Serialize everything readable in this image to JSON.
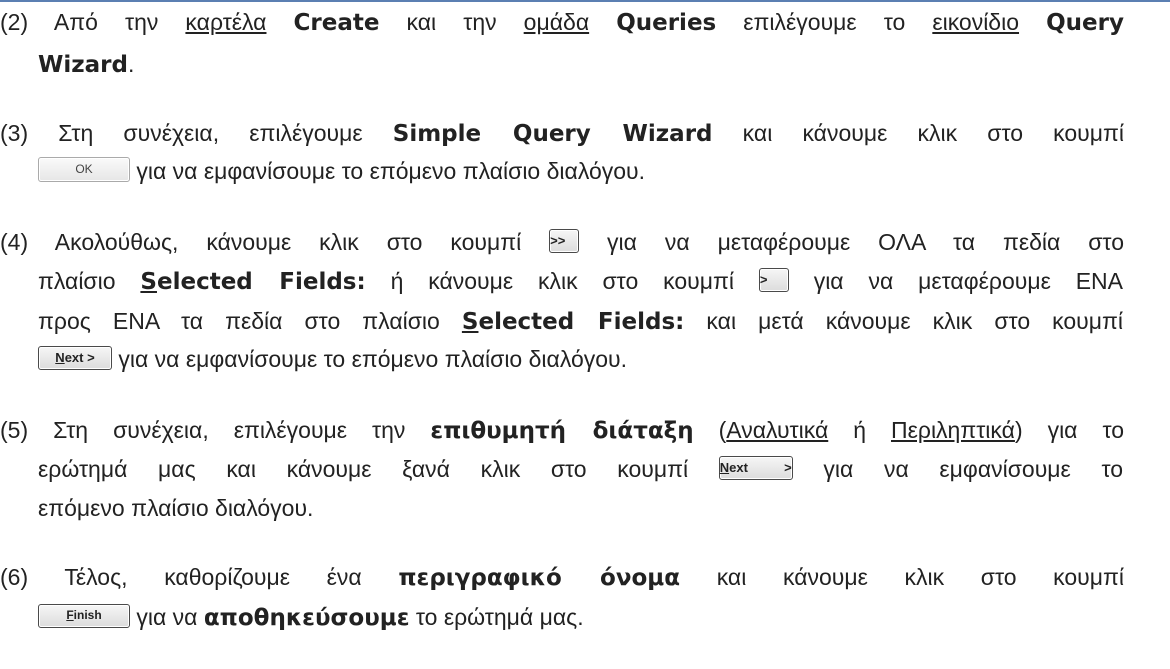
{
  "steps": [
    {
      "number": "(2)",
      "line1": {
        "t1": "Από την ",
        "u1": "καρτέλα",
        "b1": "Create",
        "t2": " και την ",
        "u2": "ομάδα",
        "b2": "Queries",
        "t3": " επιλέγουμε το ",
        "u3": "εικονίδιο",
        "b3": "Query"
      },
      "line2": {
        "b1": "Wizard",
        "t1": "."
      }
    },
    {
      "number": "(3)",
      "line1": {
        "t1": "Στη συνέχεια, επιλέγουμε ",
        "b1": "Simple Query Wizard",
        "t2": " και κάνουμε κλικ στο κουμπί"
      },
      "line2": {
        "button": "OK",
        "t1": " για να εμφανίσουμε το επόμενο πλαίσιο διαλόγου."
      }
    },
    {
      "number": "(4)",
      "line1": {
        "t1": "Ακολούθως, κάνουμε κλικ στο κουμπί ",
        "button": ">>",
        "t2": " για να μεταφέρουμε ΟΛΑ τα πεδία στο"
      },
      "line2": {
        "t1": "πλαίσιο ",
        "bmn": "S",
        "brest": "elected Fields:",
        "t2": " ή κάνουμε κλικ στο κουμπί ",
        "button": ">",
        "t3": " για να μεταφέρουμε ΕΝΑ"
      },
      "line3": {
        "t1": "προς ΕΝΑ τα πεδία στο πλαίσιο ",
        "bmn": "S",
        "brest": "elected Fields:",
        "t2": " και μετά κάνουμε κλικ στο κουμπί"
      },
      "line4": {
        "button_mn": "N",
        "button_rest": "ext >",
        "t1": " για να εμφανίσουμε το επόμενο πλαίσιο διαλόγου."
      }
    },
    {
      "number": "(5)",
      "line1": {
        "t1": "Στη συνέχεια, επιλέγουμε την ",
        "b1": "επιθυμητή διάταξη",
        "t2": " (",
        "u1": "Αναλυτικά",
        "t3": " ή ",
        "u2": "Περιληπτικά",
        "t4": ") για το"
      },
      "line2": {
        "t1": "ερώτημά μας και κάνουμε ξανά κλικ στο κουμπί ",
        "button_mn": "N",
        "button_rest": "ext >",
        "t2": " για να εμφανίσουμε το"
      },
      "line3": {
        "t1": "επόμενο πλαίσιο διαλόγου."
      }
    },
    {
      "number": "(6)",
      "line1": {
        "t1": "Τέλος, καθορίζουμε ένα ",
        "b1": "περιγραφικό όνομα",
        "t2": " και κάνουμε κλικ στο κουμπί"
      },
      "line2": {
        "button_mn": "F",
        "button_rest": "inish",
        "t1": " για να ",
        "b1": "αποθηκεύσουμε",
        "t2": " το ερώτημά μας."
      }
    }
  ]
}
